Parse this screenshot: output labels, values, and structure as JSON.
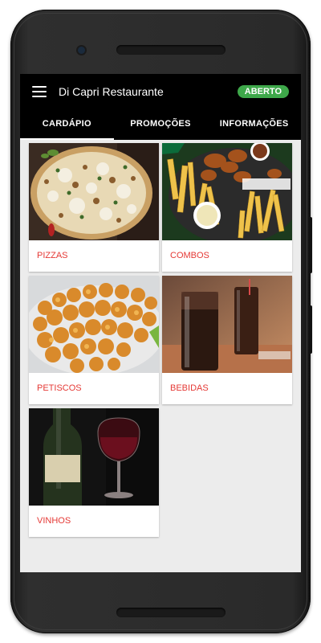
{
  "app": {
    "title": "Di Capri Restaurante",
    "status_badge": "ABERTO"
  },
  "tabs": [
    {
      "label": "CARDÁPIO",
      "active": true
    },
    {
      "label": "PROMOÇÕES",
      "active": false
    },
    {
      "label": "INFORMAÇÕES",
      "active": false
    }
  ],
  "categories": [
    {
      "label": "PIZZAS",
      "image": "pizza-image"
    },
    {
      "label": "COMBOS",
      "image": "combo-fries-wings-image"
    },
    {
      "label": "PETISCOS",
      "image": "fried-shrimp-image"
    },
    {
      "label": "BEBIDAS",
      "image": "soda-glasses-image"
    },
    {
      "label": "VINHOS",
      "image": "wine-bottle-glass-image"
    }
  ],
  "colors": {
    "appbar_bg": "#000000",
    "badge_green": "#3ea84a",
    "category_label": "#e53935",
    "content_bg": "#ececec"
  }
}
